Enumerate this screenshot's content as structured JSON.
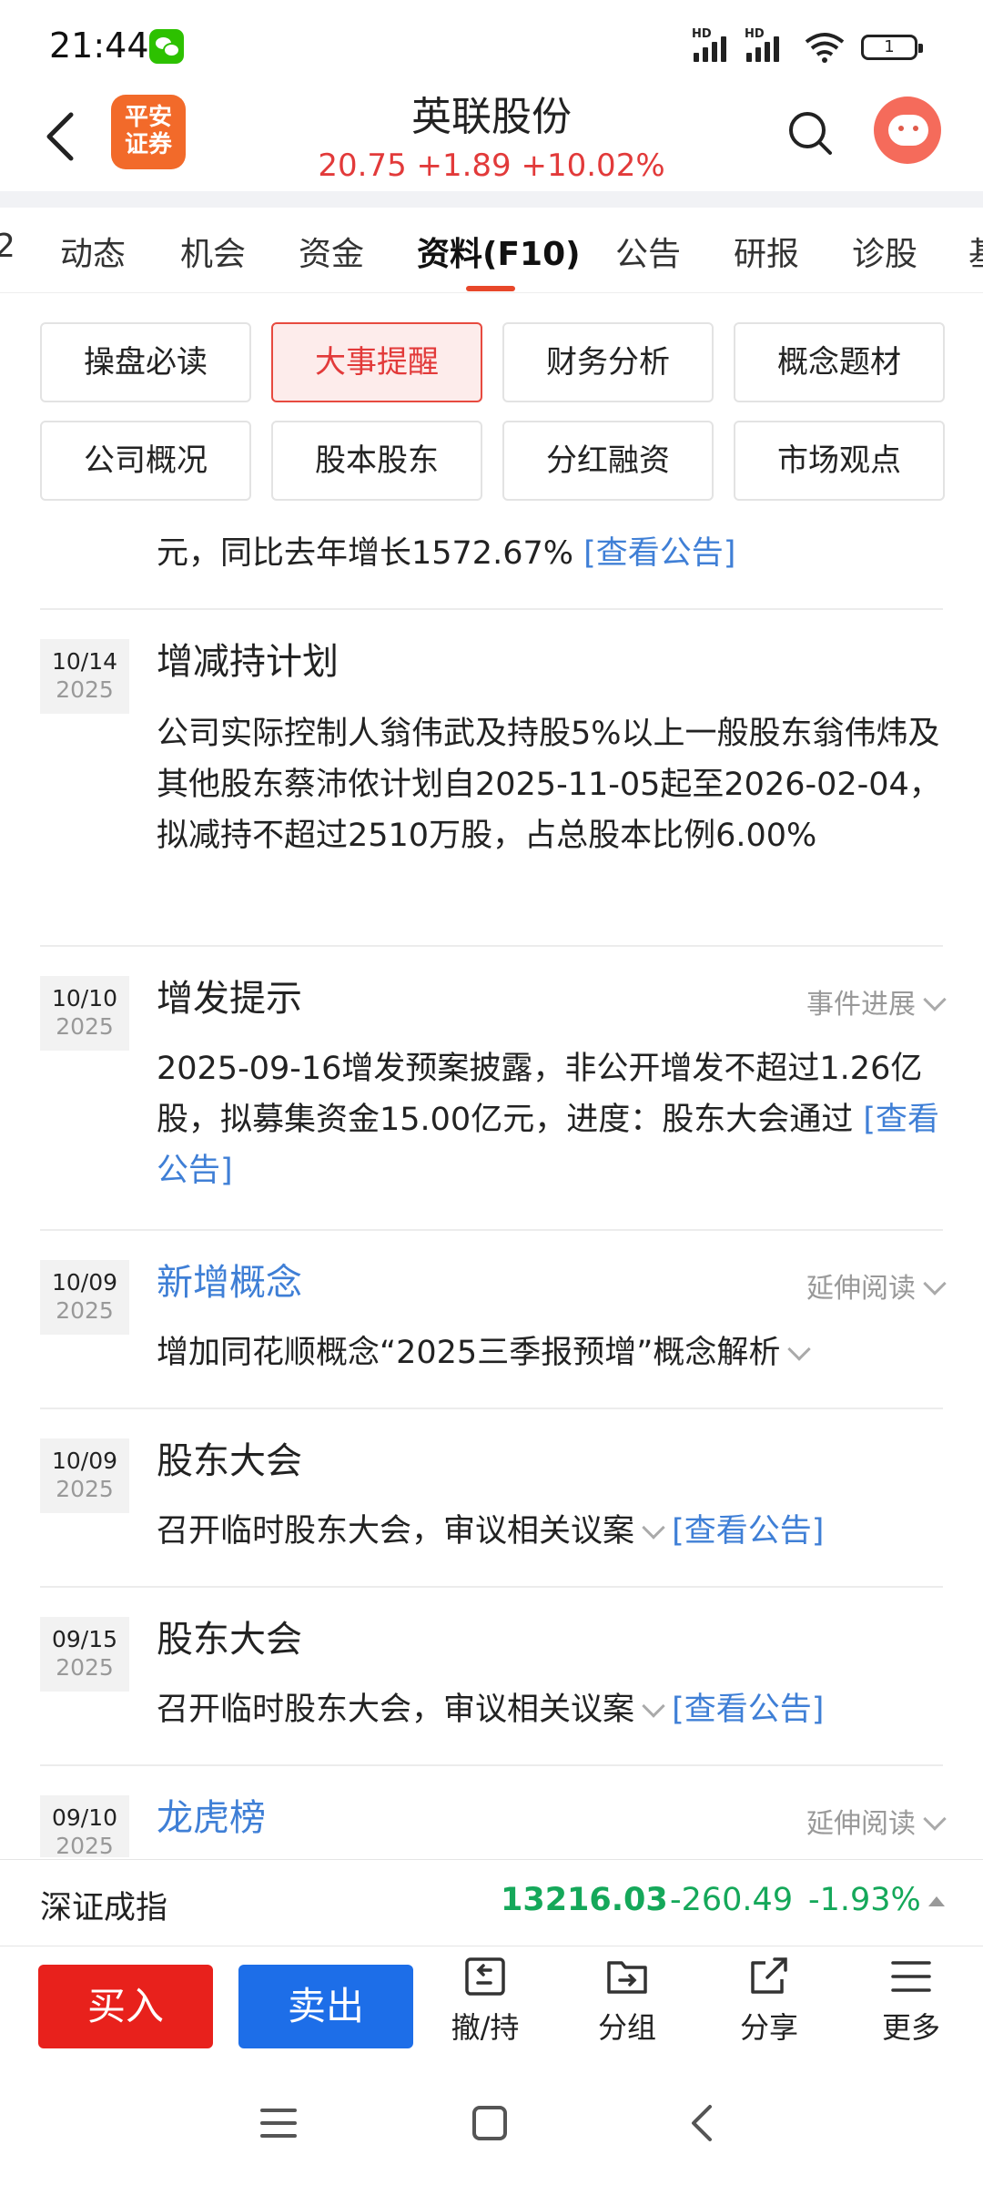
{
  "status_bar": {
    "time": "21:44",
    "hd1": "HD",
    "hd2": "HD",
    "battery": "1"
  },
  "header": {
    "logo_line1": "平安",
    "logo_line2": "证券",
    "stock_name": "英联股份",
    "quote": "20.75 +1.89 +10.02%"
  },
  "tabs": [
    {
      "label": "2"
    },
    {
      "label": "动态"
    },
    {
      "label": "机会"
    },
    {
      "label": "资金"
    },
    {
      "label": "资料(F10)"
    },
    {
      "label": "公告"
    },
    {
      "label": "研报"
    },
    {
      "label": "诊股"
    },
    {
      "label": "基"
    }
  ],
  "sections": [
    {
      "label": "操盘必读"
    },
    {
      "label": "大事提醒"
    },
    {
      "label": "财务分析"
    },
    {
      "label": "概念题材"
    },
    {
      "label": "公司概况"
    },
    {
      "label": "股本股东"
    },
    {
      "label": "分红融资"
    },
    {
      "label": "市场观点"
    }
  ],
  "top_snippet": {
    "text": "元，同比去年增长1572.67%",
    "link": "[查看公告]"
  },
  "events": [
    {
      "md": "10/14",
      "year": "2025",
      "title": "增减持计划",
      "body": "公司实际控制人翁伟武及持股5%以上一般股东翁伟炜及其他股东蔡沛侬计划自2025-11-05起至2026-02-04，拟减持不超过2510万股，占总股本比例6.00%"
    },
    {
      "md": "10/10",
      "year": "2025",
      "title": "增发提示",
      "action": "事件进展",
      "body": "2025-09-16增发预案披露，非公开增发不超过1.26亿股，拟募集资金15.00亿元，进度：股东大会通过",
      "link": "[查看公告]"
    },
    {
      "md": "10/09",
      "year": "2025",
      "title": "新增概念",
      "action": "延伸阅读",
      "body": "增加同花顺概念“2025三季报预增”概念解析"
    },
    {
      "md": "10/09",
      "year": "2025",
      "title": "股东大会",
      "body": "召开临时股东大会，审议相关议案",
      "link": "[查看公告]"
    },
    {
      "md": "09/15",
      "year": "2025",
      "title": "股东大会",
      "body": "召开临时股东大会，审议相关议案",
      "link": "[查看公告]"
    },
    {
      "md": "09/10",
      "year": "2025",
      "title": "龙虎榜",
      "action": "延伸阅读"
    }
  ],
  "index_bar": {
    "name": "深证成指",
    "value": "13216.03",
    "change": "-260.49",
    "pct": "-1.93%"
  },
  "toolbar": {
    "buy": "买入",
    "sell": "卖出",
    "cancel_hold": "撤/持",
    "group": "分组",
    "share": "分享",
    "more": "更多"
  },
  "colors": {
    "up_red": "#e23a3a",
    "down_green": "#15a85a",
    "link_blue": "#3f7fd6",
    "buy": "#e8211c",
    "sell": "#1d6ee8"
  }
}
